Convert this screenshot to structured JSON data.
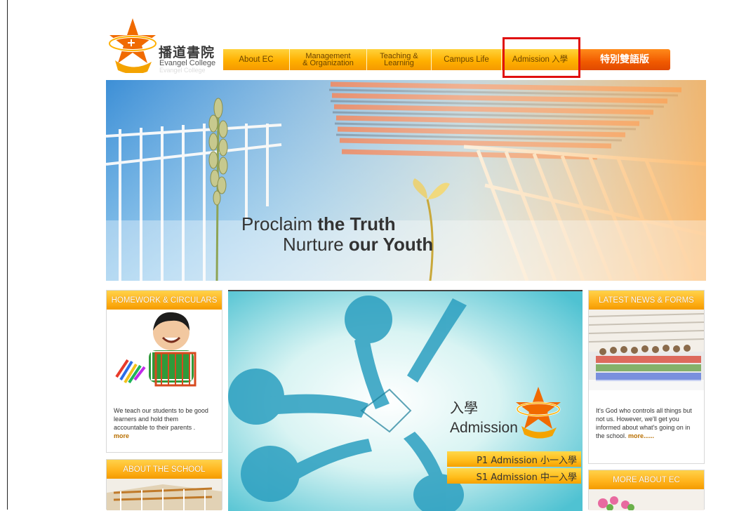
{
  "logo": {
    "zh": "播道書院",
    "en": "Evangel College"
  },
  "nav": {
    "about": "About EC",
    "management_1": "Management",
    "management_2": "& Organization",
    "teaching_1": "Teaching &",
    "teaching_2": "Learning",
    "campus": "Campus Life",
    "admission": "Admission 入學",
    "special": "特別雙語版"
  },
  "banner": {
    "line1_a": "Proclaim ",
    "line1_b": "the Truth",
    "line2_a": "Nurture ",
    "line2_b": "our Youth"
  },
  "homework": {
    "title": "HOMEWORK & CIRCULARS",
    "text": "We teach our students to be good learners and hold them accountable to their parents .",
    "more": "more"
  },
  "about_school": {
    "title": "ABOUT THE SCHOOL"
  },
  "admission_panel": {
    "zh": "入學",
    "en": "Admission",
    "p1": "P1 Admission 小一入學",
    "s1": "S1 Admission 中一入學"
  },
  "news": {
    "title": "LATEST NEWS & FORMS",
    "text": "It's God who controls all things but not us. However, we'll get you informed about what's going on in the school.",
    "more": "more......"
  },
  "more_about": {
    "title": "MORE ABOUT EC"
  },
  "colors": {
    "accent": "#ffb000",
    "special": "#f15a00",
    "highlight": "#e01010"
  }
}
